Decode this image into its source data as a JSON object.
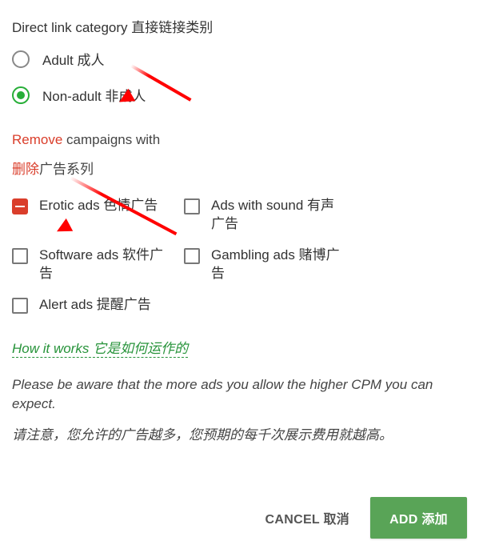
{
  "section_title": "Direct link category 直接链接类别",
  "radios": {
    "adult": {
      "label": "Adult 成人",
      "checked": false
    },
    "nonadult": {
      "label": "Non-adult 非成人",
      "checked": true
    }
  },
  "remove_heading": {
    "prefix_red": "Remove",
    "rest": " campaigns with"
  },
  "remove_heading_cn": {
    "prefix_red": "删除",
    "rest": "广告系列"
  },
  "checkboxes": {
    "erotic": {
      "label": "Erotic ads 色情广告",
      "state": "indeterminate"
    },
    "sound": {
      "label": "Ads with sound 有声广告",
      "state": "unchecked"
    },
    "software": {
      "label": "Software ads 软件广告",
      "state": "unchecked"
    },
    "gambling": {
      "label": "Gambling ads 赌博广告",
      "state": "unchecked"
    },
    "alert": {
      "label": "Alert ads 提醒广告",
      "state": "unchecked"
    }
  },
  "how_it_works": "How it works 它是如何运作的",
  "notice_en": "Please be aware that the more ads you allow the higher CPM you can expect.",
  "notice_cn": "请注意，您允许的广告越多，您预期的每千次展示费用就越高。",
  "buttons": {
    "cancel": "CANCEL 取消",
    "add": "ADD 添加"
  }
}
